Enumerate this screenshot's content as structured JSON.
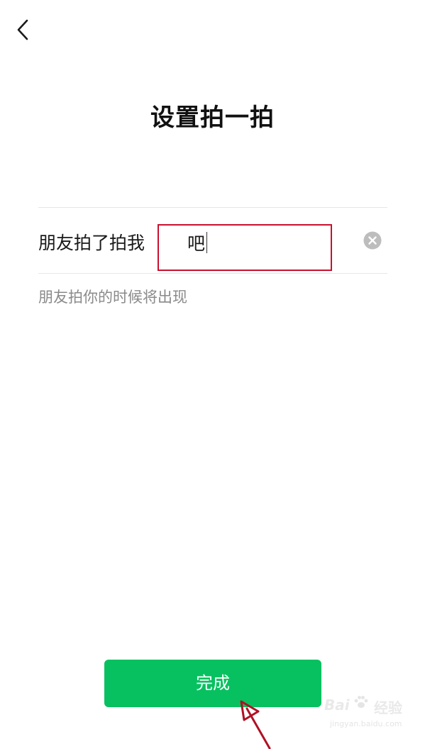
{
  "header": {
    "back_icon": "chevron-left-icon",
    "title": "设置拍一拍"
  },
  "pat_setting": {
    "prefix": "朋友拍了拍我",
    "input_value": "吧",
    "clear_icon": "clear-circle-icon",
    "hint": "朋友拍你的时候将出现"
  },
  "actions": {
    "done_label": "完成"
  },
  "annotations": {
    "highlight_color": "#c8102e",
    "arrow_color": "#b01024"
  },
  "watermark": {
    "logo": "Bai",
    "text": "经验",
    "url": "jingyan.baidu.com"
  },
  "colors": {
    "accent": "#07c160",
    "text": "#1a1a1a",
    "hint": "#8a8a8a"
  }
}
